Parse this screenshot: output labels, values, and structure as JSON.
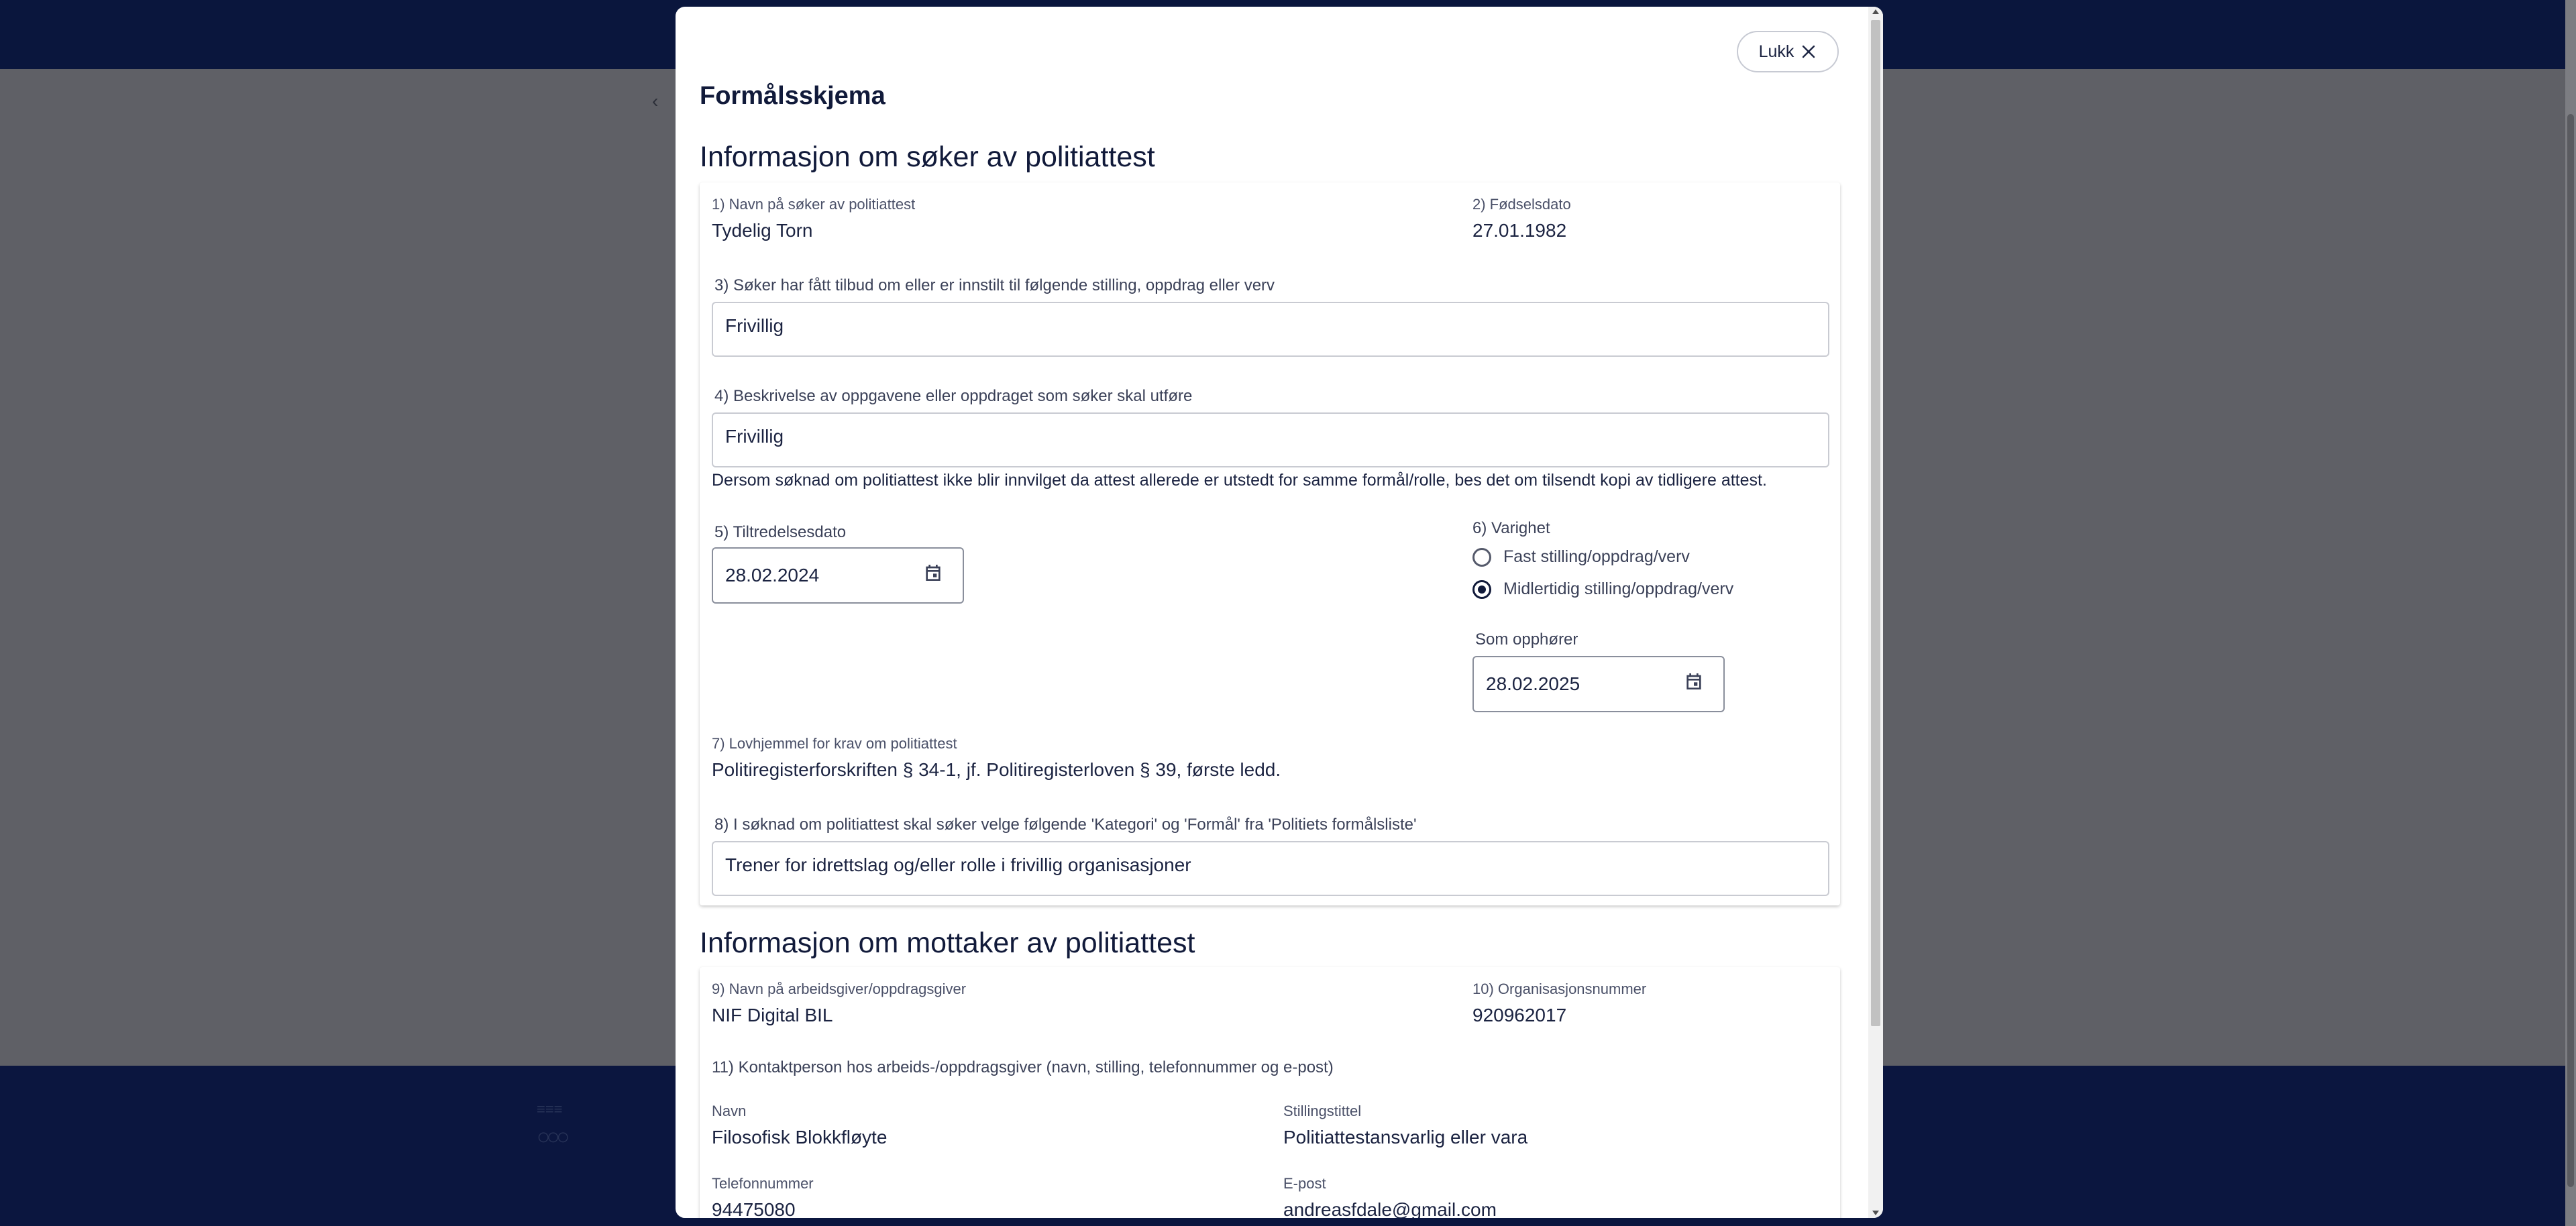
{
  "modal": {
    "title": "Formålsskjema",
    "close_label": "Lukk",
    "section_applicant": {
      "title": "Informasjon om søker av politiattest",
      "name_label": "1) Navn på søker av politiattest",
      "name_value": "Tydelig Torn",
      "dob_label": "2) Fødselsdato",
      "dob_value": "27.01.1982",
      "position_label": "3) Søker har fått tilbud om eller er innstilt til følgende stilling, oppdrag eller verv",
      "position_value": "Frivillig",
      "description_label": "4) Beskrivelse av oppgavene eller oppdraget som søker skal utføre",
      "description_value": "Frivillig",
      "note": "Dersom søknad om politiattest ikke blir innvilget da attest allerede er utstedt for samme formål/rolle, bes det om tilsendt kopi av tidligere attest.",
      "start_date_label": "5) Tiltredelsesdato",
      "start_date_value": "28.02.2024",
      "duration_label": "6) Varighet",
      "duration_options": [
        "Fast stilling/oppdrag/verv",
        "Midlertidig stilling/oppdrag/verv"
      ],
      "duration_selected": "Midlertidig stilling/oppdrag/verv",
      "end_label": "Som opphører",
      "end_value": "28.02.2025",
      "legal_label": "7) Lovhjemmel for krav om politiattest",
      "legal_value": "Politiregisterforskriften § 34-1, jf. Politiregisterloven § 39, første ledd.",
      "category_label": "8) I søknad om politiattest skal søker velge følgende 'Kategori' og 'Formål' fra 'Politiets formålsliste'",
      "category_value": "Trener for idrettslag og/eller rolle i frivillig organisasjoner"
    },
    "section_recipient": {
      "title": "Informasjon om mottaker av politiattest",
      "employer_label": "9) Navn på arbeidsgiver/oppdragsgiver",
      "employer_value": "NIF Digital BIL",
      "orgnr_label": "10) Organisasjonsnummer",
      "orgnr_value": "920962017",
      "contact_label": "11) Kontaktperson hos arbeids-/oppdragsgiver (navn, stilling, telefonnummer og e-post)",
      "contact_name_label": "Navn",
      "contact_name_value": "Filosofisk Blokkfløyte",
      "contact_title_label": "Stillingstittel",
      "contact_title_value": "Politiattestansvarlig eller vara",
      "contact_phone_label": "Telefonnummer",
      "contact_phone_value": "94475080",
      "contact_email_label": "E-post",
      "contact_email_value": "andreasfdale@gmail.com"
    }
  },
  "icons": {
    "close": "close-icon",
    "calendar": "calendar-icon"
  }
}
